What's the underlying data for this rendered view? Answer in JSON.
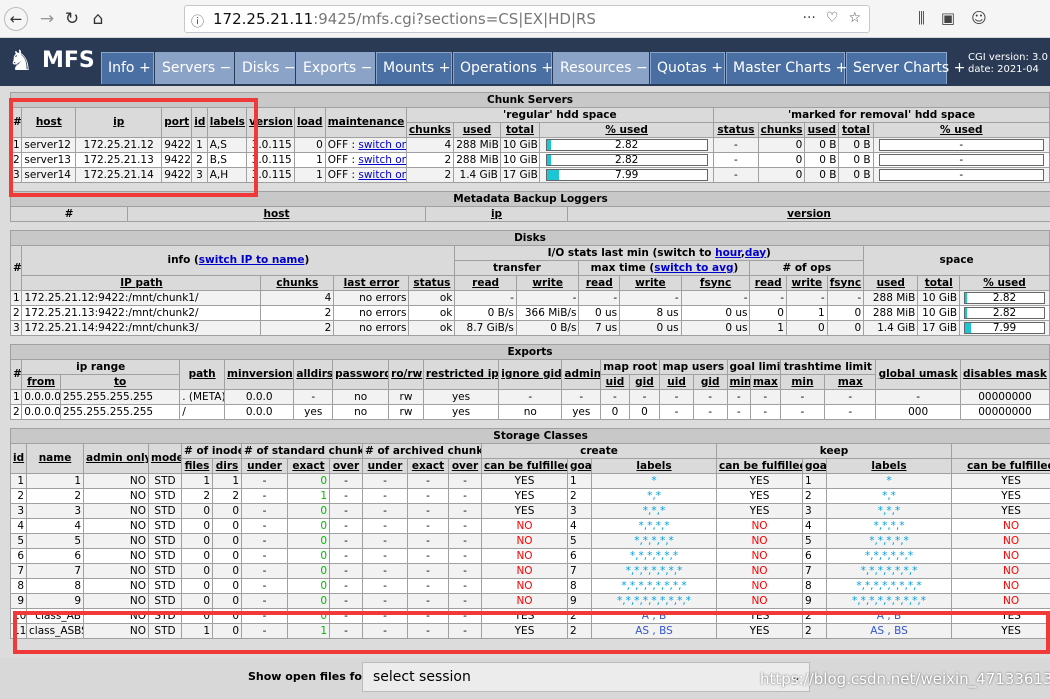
{
  "browser": {
    "url_host": "172.25.21.11",
    "url_rest": ":9425/mfs.cgi?sections=CS|EX|HD|RS",
    "icons": [
      "back-icon",
      "forward-icon",
      "reload-icon",
      "home-icon",
      "lock-icon",
      "more-icon",
      "pocket-icon",
      "star-icon",
      "library-icon",
      "sidebar-icon",
      "account-icon"
    ]
  },
  "nav": {
    "logo": "MFS",
    "tabs": [
      {
        "label": "Info +",
        "open": false
      },
      {
        "label": "Servers −",
        "open": true
      },
      {
        "label": "Disks −",
        "open": true
      },
      {
        "label": "Exports −",
        "open": true
      },
      {
        "label": "Mounts +",
        "open": false
      },
      {
        "label": "Operations +",
        "open": false
      },
      {
        "label": "Resources −",
        "open": true
      },
      {
        "label": "Quotas +",
        "open": false
      },
      {
        "label": "Master Charts +",
        "open": false
      },
      {
        "label": "Server Charts +",
        "open": false
      }
    ],
    "cgi_version": "CGI version: 3.0",
    "cgi_date": "date: 2021-04"
  },
  "chunk_servers": {
    "title": "Chunk Servers",
    "regular": "'regular' hdd space",
    "marked": "'marked for removal' hdd space",
    "headers": [
      "#",
      "host",
      "ip",
      "port",
      "id",
      "labels",
      "version",
      "load",
      "maintenance",
      "chunks",
      "used",
      "total",
      "% used",
      "status",
      "chunks",
      "used",
      "total",
      "% used"
    ],
    "rows": [
      {
        "n": "1",
        "host": "server12",
        "ip": "172.25.21.12",
        "port": "9422",
        "id": "1",
        "labels": "A,S",
        "version": "3.0.115",
        "load": "0",
        "maint": "OFF : ",
        "switch": "switch on",
        "chunks": "4",
        "used": "288 MiB",
        "total": "10 GiB",
        "pct": "2.82",
        "pctv": 2.82,
        "mstatus": "-",
        "mchunks": "0",
        "mused": "0 B",
        "mtotal": "0 B",
        "mpct": "-"
      },
      {
        "n": "2",
        "host": "server13",
        "ip": "172.25.21.13",
        "port": "9422",
        "id": "2",
        "labels": "B,S",
        "version": "3.0.115",
        "load": "1",
        "maint": "OFF : ",
        "switch": "switch on",
        "chunks": "2",
        "used": "288 MiB",
        "total": "10 GiB",
        "pct": "2.82",
        "pctv": 2.82,
        "mstatus": "-",
        "mchunks": "0",
        "mused": "0 B",
        "mtotal": "0 B",
        "mpct": "-"
      },
      {
        "n": "3",
        "host": "server14",
        "ip": "172.25.21.14",
        "port": "9422",
        "id": "3",
        "labels": "A,H",
        "version": "3.0.115",
        "load": "1",
        "maint": "OFF : ",
        "switch": "switch on",
        "chunks": "2",
        "used": "1.4 GiB",
        "total": "17 GiB",
        "pct": "7.99",
        "pctv": 7.99,
        "mstatus": "-",
        "mchunks": "0",
        "mused": "0 B",
        "mtotal": "0 B",
        "mpct": "-"
      }
    ]
  },
  "metadata_loggers": {
    "title": "Metadata Backup Loggers",
    "headers": [
      "#",
      "host",
      "ip",
      "version"
    ]
  },
  "disks": {
    "title": "Disks",
    "info": "info (",
    "switch_ip": "switch IP to name",
    "info_end": ")",
    "io_title": "I/O stats last min (switch to ",
    "io_hour": "hour",
    "io_comma": ",",
    "io_day": "day",
    "io_end": ")",
    "transfer": "transfer",
    "max_time": "max time (",
    "switch_avg": "switch to avg",
    "max_end": ")",
    "num_ops": "# of ops",
    "space": "space",
    "headers": [
      "#",
      "IP path",
      "chunks",
      "last error",
      "status",
      "read",
      "write",
      "read",
      "write",
      "fsync",
      "read",
      "write",
      "fsync",
      "used",
      "total",
      "% used"
    ],
    "rows": [
      {
        "n": "1",
        "path": "172.25.21.12:9422:/mnt/chunk1/",
        "chunks": "4",
        "err": "no errors",
        "status": "ok",
        "tr": "-",
        "tw": "-",
        "mr": "-",
        "mw": "-",
        "mf": "-",
        "or": "-",
        "ow": "-",
        "of": "-",
        "used": "288 MiB",
        "total": "10 GiB",
        "pct": "2.82",
        "pctv": 2.82
      },
      {
        "n": "2",
        "path": "172.25.21.13:9422:/mnt/chunk2/",
        "chunks": "2",
        "err": "no errors",
        "status": "ok",
        "tr": "0 B/s",
        "tw": "366 MiB/s",
        "mr": "0 us",
        "mw": "8 us",
        "mf": "0 us",
        "or": "0",
        "ow": "1",
        "of": "0",
        "used": "288 MiB",
        "total": "10 GiB",
        "pct": "2.82",
        "pctv": 2.82
      },
      {
        "n": "3",
        "path": "172.25.21.14:9422:/mnt/chunk3/",
        "chunks": "2",
        "err": "no errors",
        "status": "ok",
        "tr": "8.7 GiB/s",
        "tw": "0 B/s",
        "mr": "7 us",
        "mw": "0 us",
        "mf": "0 us",
        "or": "1",
        "ow": "0",
        "of": "0",
        "used": "1.4 GiB",
        "total": "17 GiB",
        "pct": "7.99",
        "pctv": 7.99
      }
    ]
  },
  "exports": {
    "title": "Exports",
    "ip_range": "ip range",
    "map_root": "map root",
    "map_users": "map users",
    "goal_limit": "goal limit",
    "trash_limit": "trashtime limit",
    "headers": [
      "#",
      "from",
      "to",
      "path",
      "minversion",
      "alldirs",
      "password",
      "ro/rw",
      "restricted ip",
      "ignore gid",
      "admin",
      "uid",
      "gid",
      "uid",
      "gid",
      "min",
      "max",
      "min",
      "max",
      "global umask",
      "disables mask"
    ],
    "rows": [
      [
        "1",
        "0.0.0.0",
        "255.255.255.255",
        ". (META)",
        "0.0.0",
        "-",
        "no",
        "rw",
        "yes",
        "-",
        "-",
        "-",
        "-",
        "-",
        "-",
        "-",
        "-",
        "-",
        "-",
        "-",
        "00000000"
      ],
      [
        "2",
        "0.0.0.0",
        "255.255.255.255",
        "/",
        "0.0.0",
        "yes",
        "no",
        "rw",
        "yes",
        "no",
        "yes",
        "0",
        "0",
        "-",
        "-",
        "-",
        "-",
        "-",
        "-",
        "000",
        "00000000"
      ]
    ]
  },
  "storage_classes": {
    "title": "Storage Classes",
    "n_inodes": "# of inodes",
    "n_std": "# of standard chunks",
    "n_arch": "# of archived chunks",
    "create": "create",
    "keep": "keep",
    "headers": [
      "id",
      "name",
      "admin only",
      "mode",
      "files",
      "dirs",
      "under",
      "exact",
      "over",
      "under",
      "exact",
      "over",
      "can be fulfilled",
      "goal",
      "labels",
      "can be fulfilled",
      "goal",
      "labels",
      "can be fulfilled"
    ],
    "rows": [
      {
        "id": "1",
        "name": "1",
        "admin": "NO",
        "mode": "STD",
        "files": "1",
        "dirs": "1",
        "su": "-",
        "se": "0",
        "so": "-",
        "au": "-",
        "ae": "-",
        "ao": "-",
        "cf": "YES",
        "cg": "1",
        "cl": "*",
        "kf": "YES",
        "kg": "1",
        "kl": "*",
        "af": "YES"
      },
      {
        "id": "2",
        "name": "2",
        "admin": "NO",
        "mode": "STD",
        "files": "2",
        "dirs": "2",
        "su": "-",
        "se": "1",
        "so": "-",
        "au": "-",
        "ae": "-",
        "ao": "-",
        "cf": "YES",
        "cg": "2",
        "cl": "*,*",
        "kf": "YES",
        "kg": "2",
        "kl": "*,*",
        "af": "YES"
      },
      {
        "id": "3",
        "name": "3",
        "admin": "NO",
        "mode": "STD",
        "files": "0",
        "dirs": "0",
        "su": "-",
        "se": "0",
        "so": "-",
        "au": "-",
        "ae": "-",
        "ao": "-",
        "cf": "YES",
        "cg": "3",
        "cl": "*,*,*",
        "kf": "YES",
        "kg": "3",
        "kl": "*,*,*",
        "af": "YES"
      },
      {
        "id": "4",
        "name": "4",
        "admin": "NO",
        "mode": "STD",
        "files": "0",
        "dirs": "0",
        "su": "-",
        "se": "0",
        "so": "-",
        "au": "-",
        "ae": "-",
        "ao": "-",
        "cf": "NO",
        "cg": "4",
        "cl": "*,*,*,*",
        "kf": "NO",
        "kg": "4",
        "kl": "*,*,*,*",
        "af": "NO"
      },
      {
        "id": "5",
        "name": "5",
        "admin": "NO",
        "mode": "STD",
        "files": "0",
        "dirs": "0",
        "su": "-",
        "se": "0",
        "so": "-",
        "au": "-",
        "ae": "-",
        "ao": "-",
        "cf": "NO",
        "cg": "5",
        "cl": "*,*,*,*,*",
        "kf": "NO",
        "kg": "5",
        "kl": "*,*,*,*,*",
        "af": "NO"
      },
      {
        "id": "6",
        "name": "6",
        "admin": "NO",
        "mode": "STD",
        "files": "0",
        "dirs": "0",
        "su": "-",
        "se": "0",
        "so": "-",
        "au": "-",
        "ae": "-",
        "ao": "-",
        "cf": "NO",
        "cg": "6",
        "cl": "*,*,*,*,*,*",
        "kf": "NO",
        "kg": "6",
        "kl": "*,*,*,*,*,*",
        "af": "NO"
      },
      {
        "id": "7",
        "name": "7",
        "admin": "NO",
        "mode": "STD",
        "files": "0",
        "dirs": "0",
        "su": "-",
        "se": "0",
        "so": "-",
        "au": "-",
        "ae": "-",
        "ao": "-",
        "cf": "NO",
        "cg": "7",
        "cl": "*,*,*,*,*,*,*",
        "kf": "NO",
        "kg": "7",
        "kl": "*,*,*,*,*,*,*",
        "af": "NO"
      },
      {
        "id": "8",
        "name": "8",
        "admin": "NO",
        "mode": "STD",
        "files": "0",
        "dirs": "0",
        "su": "-",
        "se": "0",
        "so": "-",
        "au": "-",
        "ae": "-",
        "ao": "-",
        "cf": "NO",
        "cg": "8",
        "cl": "*,*,*,*,*,*,*,*",
        "kf": "NO",
        "kg": "8",
        "kl": "*,*,*,*,*,*,*,*",
        "af": "NO"
      },
      {
        "id": "9",
        "name": "9",
        "admin": "NO",
        "mode": "STD",
        "files": "0",
        "dirs": "0",
        "su": "-",
        "se": "0",
        "so": "-",
        "au": "-",
        "ae": "-",
        "ao": "-",
        "cf": "NO",
        "cg": "9",
        "cl": "*,*,*,*,*,*,*,*,*",
        "kf": "NO",
        "kg": "9",
        "kl": "*,*,*,*,*,*,*,*,*",
        "af": "NO"
      },
      {
        "id": "10",
        "name": "class_AB",
        "admin": "NO",
        "mode": "STD",
        "files": "0",
        "dirs": "0",
        "su": "-",
        "se": "0",
        "so": "-",
        "au": "-",
        "ae": "-",
        "ao": "-",
        "cf": "YES",
        "cg": "2",
        "cl": "A , B",
        "kf": "YES",
        "kg": "2",
        "kl": "A , B",
        "af": "YES"
      },
      {
        "id": "11",
        "name": "class_ASBS",
        "admin": "NO",
        "mode": "STD",
        "files": "1",
        "dirs": "0",
        "su": "-",
        "se": "1",
        "so": "-",
        "au": "-",
        "ae": "-",
        "ao": "-",
        "cf": "YES",
        "cg": "2",
        "cl": "AS , BS",
        "kf": "YES",
        "kg": "2",
        "kl": "AS , BS",
        "af": "YES"
      }
    ]
  },
  "session": {
    "label": "Show open files for:",
    "value": "select session"
  },
  "watermark": "https://blog.csdn.net/weixin_47133613"
}
